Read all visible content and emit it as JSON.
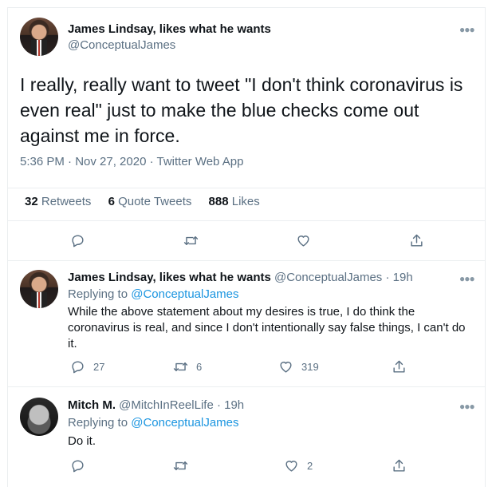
{
  "main": {
    "author_name": "James Lindsay, likes what he wants",
    "author_handle": "@ConceptualJames",
    "text": "I really, really want to tweet \"I don't think coronavirus is even real\" just to make the blue checks come out against me in force.",
    "timestamp": "5:36 PM · Nov 27, 2020 · Twitter Web App",
    "stats": {
      "retweets_count": "32",
      "retweets_label": "Retweets",
      "quotes_count": "6",
      "quotes_label": "Quote Tweets",
      "likes_count": "888",
      "likes_label": "Likes"
    }
  },
  "replies": [
    {
      "author_name": "James Lindsay, likes what he wants",
      "author_handle": "@ConceptualJames",
      "time": "· 19h",
      "replying_prefix": "Replying to",
      "replying_to": "@ConceptualJames",
      "text": "While the above statement about my desires is true, I do think the coronavirus is real, and since I don't intentionally say false things, I can't do it.",
      "reply_count": "27",
      "retweet_count": "6",
      "like_count": "319"
    },
    {
      "author_name": "Mitch M.",
      "author_handle": "@MitchInReelLife",
      "time": "· 19h",
      "replying_prefix": "Replying to",
      "replying_to": "@ConceptualJames",
      "text": "Do it.",
      "reply_count": "",
      "retweet_count": "",
      "like_count": "2"
    }
  ],
  "icons": {
    "more": "more-icon",
    "reply": "reply-icon",
    "retweet": "retweet-icon",
    "like": "heart-icon",
    "share": "share-icon"
  },
  "colors": {
    "link": "#1b95e0",
    "secondary": "#5b7083",
    "border": "#ebeef0"
  }
}
